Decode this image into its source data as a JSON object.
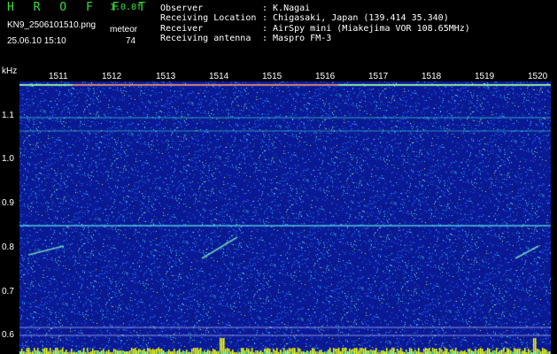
{
  "header": {
    "program": "H R O F F T",
    "version": "1.0.0f",
    "filename": "KN9_2506101510.png",
    "mode_label": "meteor",
    "datetime": "25.06.10 15:10",
    "count": "74",
    "meta": [
      {
        "key": "Observer",
        "value": ": K.Nagai"
      },
      {
        "key": "Receiving Location",
        "value": ": Chigasaki, Japan (139.414 35.340)"
      },
      {
        "key": "Receiver",
        "value": ": AirSpy mini (Miakejima VOR 108.65MHz)"
      },
      {
        "key": "Receiving antenna",
        "value": ": Maspro FM-3"
      }
    ]
  },
  "axis": {
    "unit": "kHz",
    "time_ticks": [
      "1511",
      "1512",
      "1513",
      "1514",
      "1515",
      "1516",
      "1517",
      "1518",
      "1519",
      "1520"
    ],
    "freq_ticks": [
      "1.1",
      "1.0",
      "0.9",
      "0.8",
      "0.7",
      "0.6"
    ]
  },
  "colors": {
    "background": "#000000",
    "noise": "#1a2fb0",
    "signal": "#40e0e0",
    "bars": "#ffff00",
    "text_green": "#38e038"
  }
}
